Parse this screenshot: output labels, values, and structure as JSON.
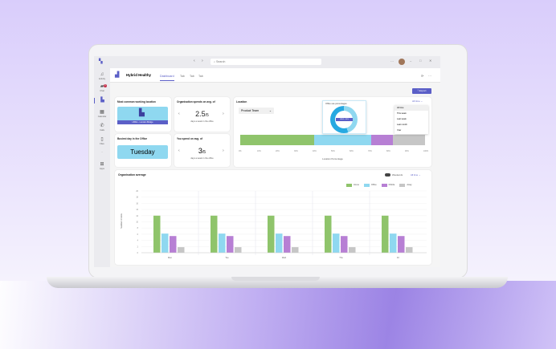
{
  "titlebar": {
    "search_placeholder": "Search",
    "more": "···"
  },
  "rail": [
    {
      "label": "Activity",
      "icon": "bell-icon"
    },
    {
      "label": "Chat",
      "icon": "chat-icon",
      "badge": "1"
    },
    {
      "label": "",
      "icon": "app-icon"
    },
    {
      "label": "Calendar",
      "icon": "calendar-icon"
    },
    {
      "label": "Calls",
      "icon": "phone-icon"
    },
    {
      "label": "Files",
      "icon": "file-icon"
    },
    {
      "label": "···",
      "icon": "more-icon"
    },
    {
      "label": "Apps",
      "icon": "apps-icon"
    }
  ],
  "app": {
    "title": "Hybrid Healthy",
    "tabs": [
      "Dashboard",
      "Tab",
      "Tab",
      "Tab"
    ],
    "export": "Export"
  },
  "cards": {
    "location_title": "Most common working location",
    "location_label": "LBSG - London Bridge",
    "busiest_title": "Busiest day in the Office",
    "busiest_value": "Tuesday",
    "org_title": "Organisation spends on avg. of",
    "org_value": "2.5",
    "org_den": "/5",
    "org_sub": "days a week in the office",
    "you_title": "You spend on avg. of",
    "you_value": "3",
    "you_den": "/5",
    "you_sub": "days a week in the office"
  },
  "location": {
    "title": "Location",
    "team": "Product Team",
    "range": "All time",
    "menu": [
      "All time",
      "This week",
      "Last week",
      "Last month",
      "Year"
    ],
    "popup_title": "Office use percentages",
    "popup_label": "LBSG - 54%",
    "xlabel": "Location Percentage",
    "ticks": [
      "0%",
      "10%",
      "20%",
      "30%",
      "40%",
      "50%",
      "60%",
      "70%",
      "80%",
      "90%",
      "100%"
    ],
    "segments": [
      {
        "name": "Home",
        "pct": 40,
        "color": "#8fc46b"
      },
      {
        "name": "Office",
        "pct": 31,
        "color": "#8fd8f0"
      },
      {
        "name": "Mobile",
        "pct": 11.5,
        "color": "#b77fd4"
      },
      {
        "name": "Away",
        "pct": 17.5,
        "color": "#c6c6c6"
      }
    ]
  },
  "chart_data": {
    "type": "bar",
    "title": "Organisation average",
    "ylabel": "Number of visits",
    "categories": [
      "Mon",
      "Tue",
      "Wed",
      "Thu",
      "Fri"
    ],
    "ylim": [
      0,
      20
    ],
    "yticks": [
      "0",
      "2",
      "4",
      "6",
      "8",
      "10",
      "12",
      "14",
      "16",
      "18",
      "20"
    ],
    "series": [
      {
        "name": "Home",
        "color": "#8fc46b",
        "values": [
          12,
          12,
          12,
          12,
          12
        ]
      },
      {
        "name": "Office",
        "color": "#8fd8f0",
        "values": [
          6.2,
          6.2,
          6.2,
          6.2,
          6.2
        ]
      },
      {
        "name": "Mobile",
        "color": "#b77fd4",
        "values": [
          5.4,
          5.4,
          5.4,
          5.4,
          5.4
        ]
      },
      {
        "name": "Away",
        "color": "#c6c6c6",
        "values": [
          1.8,
          1.8,
          1.8,
          1.8,
          1.8
        ]
      }
    ],
    "weekends": "Weekends",
    "range": "All time"
  }
}
